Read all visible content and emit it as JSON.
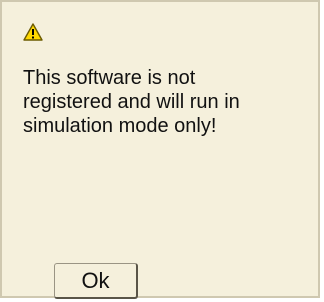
{
  "dialog": {
    "icon": "warning-icon",
    "message": "This software is not\nregistered and will run in\nsimulation mode only!",
    "ok_label": "Ok"
  },
  "colors": {
    "background": "#f5f0dc",
    "warning_fill": "#ffd800",
    "warning_outline": "#6b5a00"
  }
}
